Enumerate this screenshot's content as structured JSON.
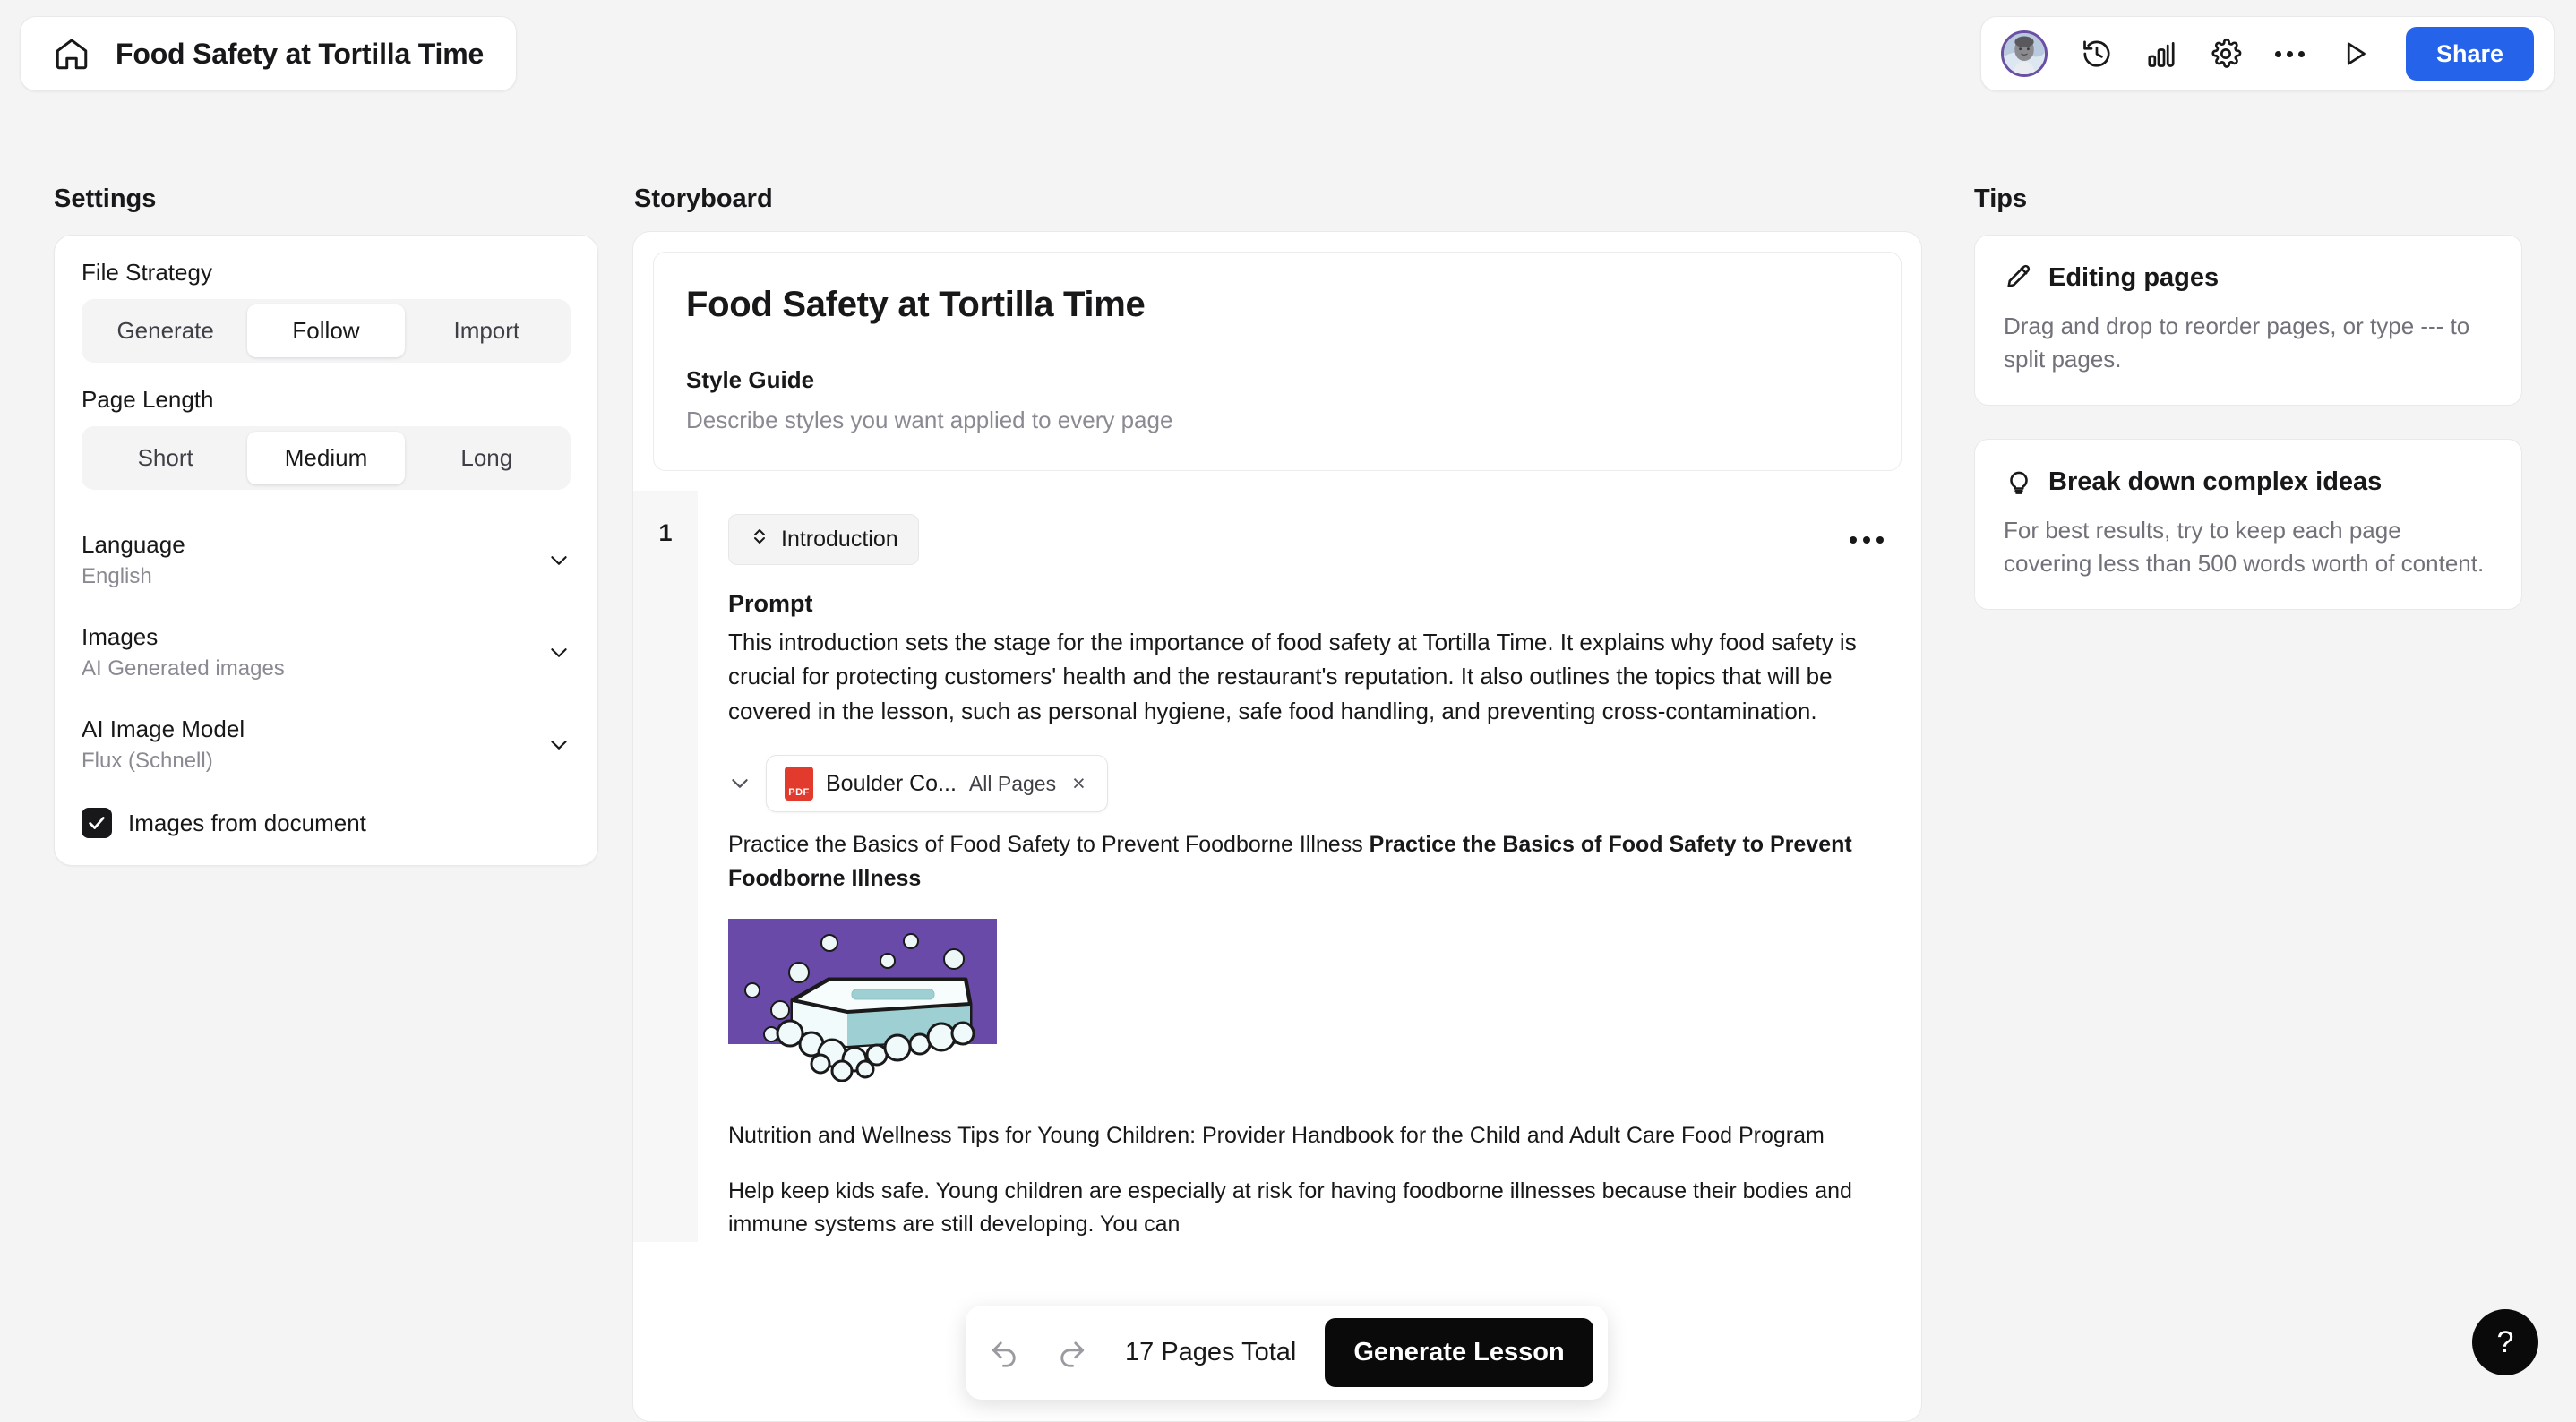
{
  "header": {
    "home_icon": "home-icon",
    "doc_title": "Food Safety at Tortilla Time",
    "toolbar": {
      "avatar": "user-avatar",
      "history_icon": "history-icon",
      "analytics_icon": "bar-chart-icon",
      "settings_icon": "gear-icon",
      "more_icon": "ellipsis-icon",
      "preview_icon": "play-icon",
      "share_label": "Share",
      "share_color": "#2563eb"
    }
  },
  "columns": {
    "settings_heading": "Settings",
    "storyboard_heading": "Storyboard",
    "tips_heading": "Tips"
  },
  "settings": {
    "file_strategy": {
      "label": "File Strategy",
      "options": [
        "Generate",
        "Follow",
        "Import"
      ],
      "selected": "Follow"
    },
    "page_length": {
      "label": "Page Length",
      "options": [
        "Short",
        "Medium",
        "Long"
      ],
      "selected": "Medium"
    },
    "selects": [
      {
        "label": "Language",
        "value": "English"
      },
      {
        "label": "Images",
        "value": "AI Generated images"
      },
      {
        "label": "AI Image Model",
        "value": "Flux (Schnell)"
      }
    ],
    "checkbox": {
      "label": "Images from document",
      "checked": true
    }
  },
  "storyboard": {
    "title": "Food Safety at Tortilla Time",
    "style_guide_label": "Style Guide",
    "style_guide_placeholder": "Describe styles you want applied to every page",
    "page": {
      "number": "1",
      "type_chip": "Introduction",
      "prompt_label": "Prompt",
      "prompt_text": "This introduction sets the stage for the importance of food safety at Tortilla Time. It explains why food safety is crucial for protecting customers' health and the restaurant's reputation. It also outlines the topics that will be covered in the lesson, such as personal hygiene, safe food handling, and preventing cross-contamination.",
      "file": {
        "name": "Boulder Co...",
        "scope": "All Pages",
        "remove_label": "×",
        "icon": "pdf-file-icon"
      },
      "excerpt_plain": "Practice the Basics of Food Safety to Prevent Foodborne Illness ",
      "excerpt_bold": "Practice the Basics of Food Safety to Prevent Foodborne Illness",
      "image_alt": "soap-bar-illustration",
      "excerpt_2": "Nutrition and Wellness Tips for Young Children: Provider Handbook for the Child and Adult Care Food Program",
      "excerpt_3": "Help keep kids safe. Young children are especially at risk for having foodborne illnesses because their bodies and immune systems are still developing. You can"
    }
  },
  "floating_bar": {
    "undo_icon": "undo-icon",
    "redo_icon": "redo-icon",
    "page_count": "17 Pages Total",
    "generate_label": "Generate Lesson"
  },
  "tips": [
    {
      "icon": "pencil-icon",
      "title": "Editing pages",
      "body": "Drag and drop to reorder pages, or type --- to split pages."
    },
    {
      "icon": "lightbulb-icon",
      "title": "Break down complex ideas",
      "body": "For best results, try to keep each page covering less than 500 words worth of content."
    }
  ],
  "help": {
    "label": "?"
  }
}
